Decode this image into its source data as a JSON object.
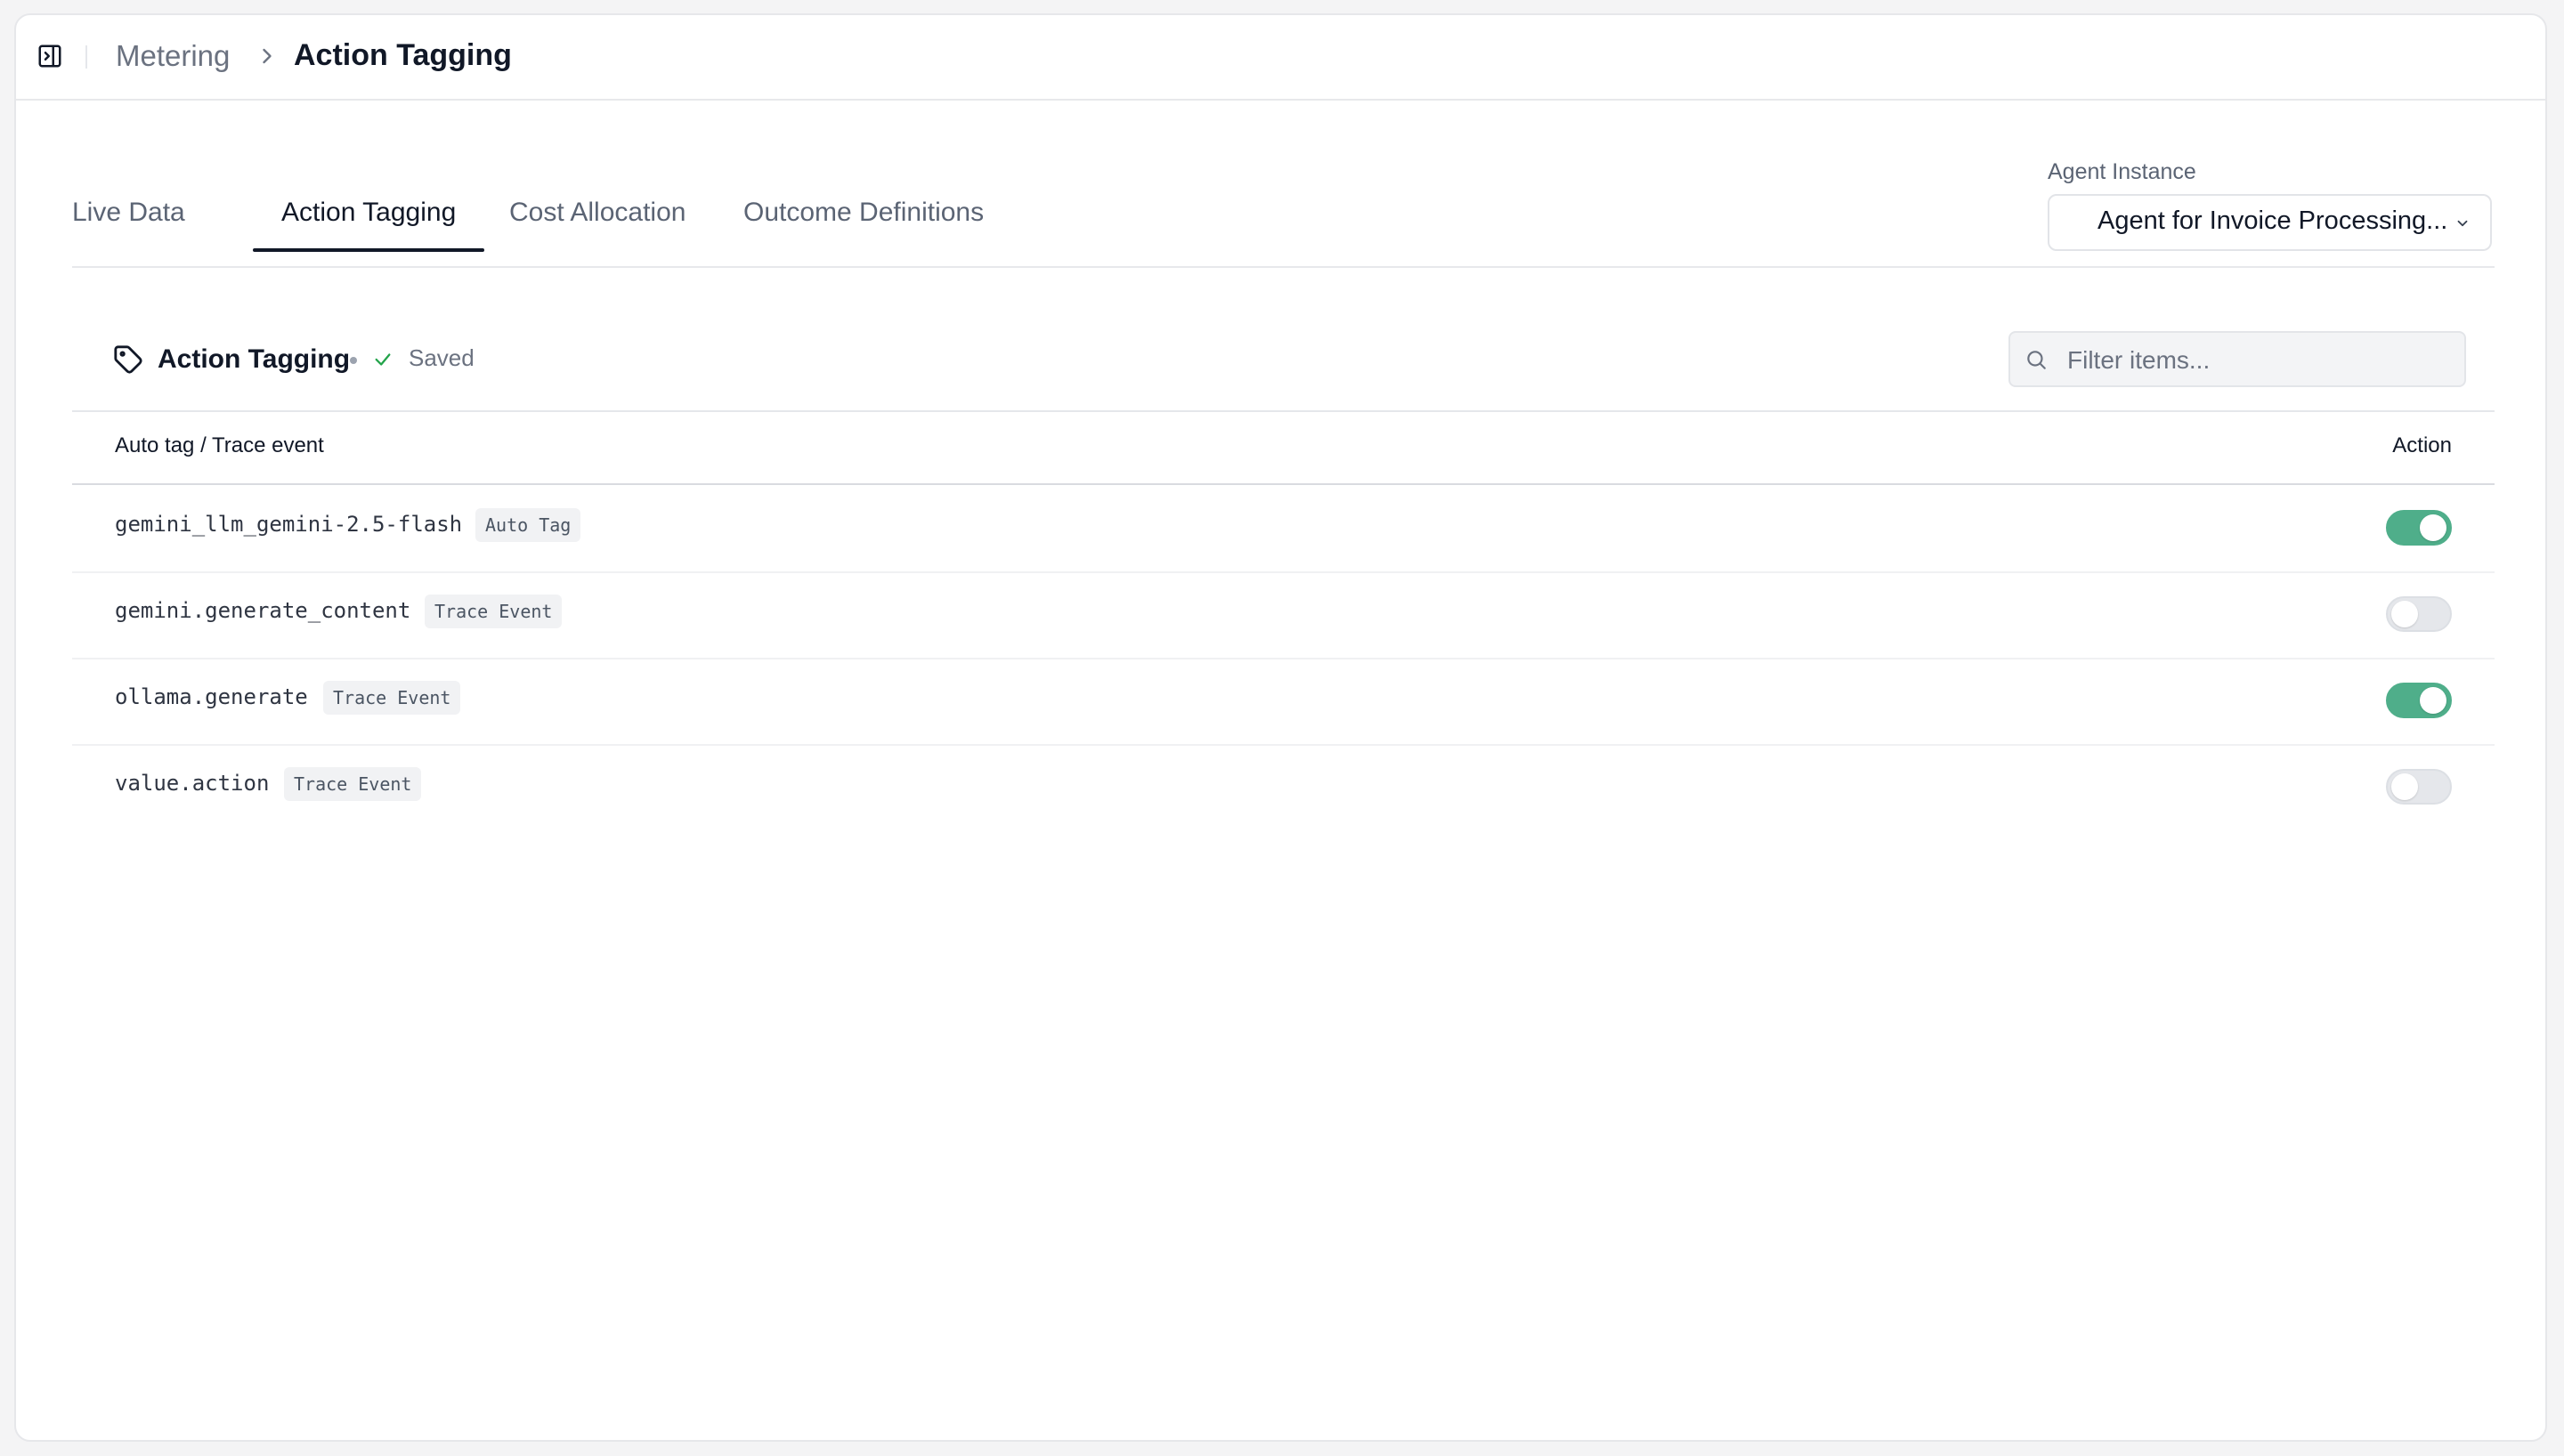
{
  "breadcrumb": {
    "parent": "Metering",
    "current": "Action Tagging"
  },
  "tabs": [
    {
      "label": "Live Data",
      "active": false
    },
    {
      "label": "Action Tagging",
      "active": true
    },
    {
      "label": "Cost Allocation",
      "active": false
    },
    {
      "label": "Outcome Definitions",
      "active": false
    }
  ],
  "agent": {
    "label": "Agent Instance",
    "selected": "Agent for Invoice Processing..."
  },
  "section": {
    "title": "Action Tagging",
    "status": "Saved"
  },
  "filter": {
    "placeholder": "Filter items..."
  },
  "table": {
    "col_left": "Auto tag / Trace event",
    "col_right": "Action",
    "rows": [
      {
        "name": "gemini_llm_gemini-2.5-flash",
        "badge": "Auto Tag",
        "enabled": true
      },
      {
        "name": "gemini.generate_content",
        "badge": "Trace Event",
        "enabled": false
      },
      {
        "name": "ollama.generate",
        "badge": "Trace Event",
        "enabled": true
      },
      {
        "name": "value.action",
        "badge": "Trace Event",
        "enabled": false
      }
    ]
  },
  "colors": {
    "toggle_on": "#4fae8a",
    "toggle_off": "#e5e7eb",
    "success": "#22a34a"
  },
  "icons": {
    "sidebar_toggle": "panel-toggle-icon",
    "breadcrumb_sep": "chevron-right-icon",
    "section": "tag-icon",
    "status": "check-icon",
    "filter": "search-icon",
    "select": "chevron-down-icon"
  }
}
